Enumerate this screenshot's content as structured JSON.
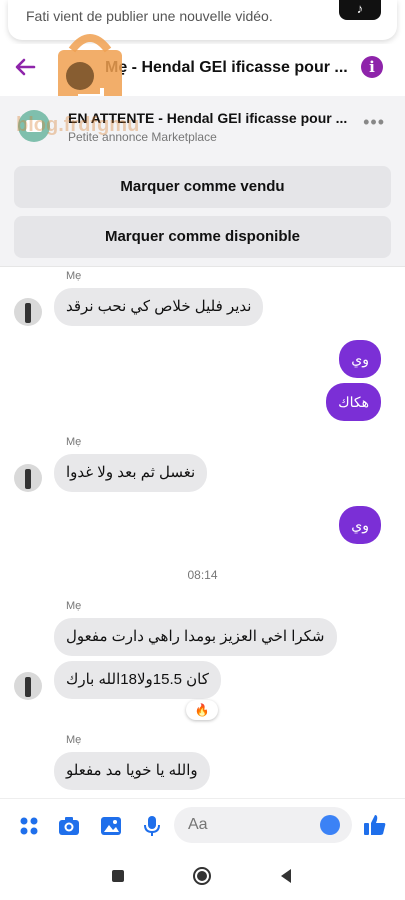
{
  "notification": {
    "text": "Fati vient de publier une nouvelle vidéo."
  },
  "header": {
    "title": "Mẹ - Hendal GEl ificasse pour ..."
  },
  "listing": {
    "watermark": "blog.frdfgmu",
    "title": "EN ATTENTE - Hendal GEl ificasse pour ...",
    "subtitle": "Petite annonce Marketplace",
    "more": "•••",
    "button_sold": "Marquer comme vendu",
    "button_available": "Marquer comme disponible"
  },
  "messages": {
    "sender_name": "Mẹ",
    "m1": "ندير فليل خلاص كي نحب نرقد",
    "m2": "وي",
    "m3": "هكاك",
    "m4": "نغسل ثم بعد ولا غدوا",
    "m5": "وي",
    "time": "08:14",
    "m6": "شكرا اخي العزيز بومدا راهي دارت مفعول",
    "m7": "كان 15.5ولا18الله بارك",
    "reaction": "🔥",
    "m8": "والله يا خويا مد مفعلو"
  },
  "composer": {
    "placeholder": "Aa"
  },
  "colors": {
    "accent": "#8e24aa",
    "bubble_out": "#7b2fd6",
    "bubble_in": "#e8e8ea"
  }
}
